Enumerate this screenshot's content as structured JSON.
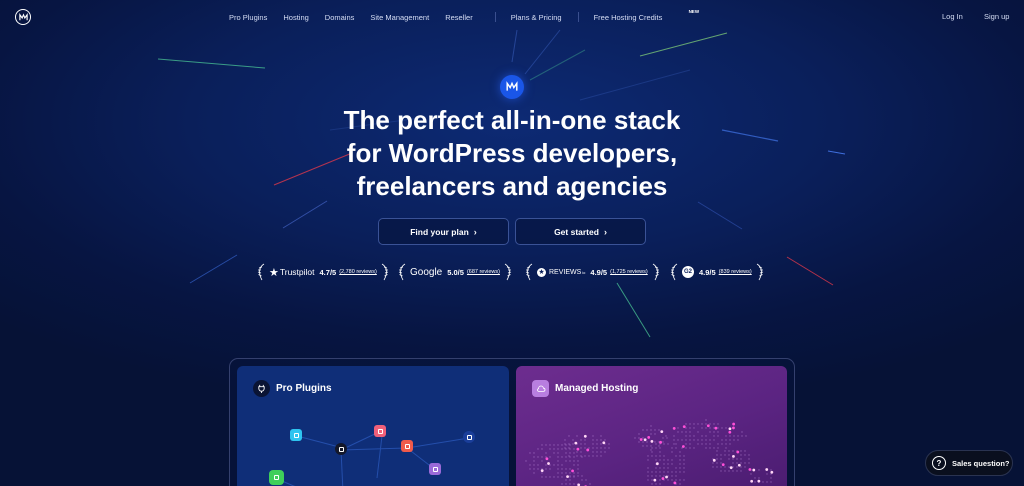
{
  "nav": {
    "links": [
      "Pro Plugins",
      "Hosting",
      "Domains",
      "Site Management",
      "Reseller",
      "Plans & Pricing",
      "Free Hosting Credits"
    ],
    "new_badge": "NEW",
    "login": "Log In",
    "signup": "Sign up"
  },
  "hero": {
    "title_lines": [
      "The perfect all-in-one stack",
      "for WordPress developers,",
      "freelancers and agencies"
    ],
    "btn_plan": "Find your plan",
    "btn_start": "Get started"
  },
  "ratings": [
    {
      "brand": "Trustpilot",
      "score": "4.7/5",
      "reviews": "(2,780 reviews)"
    },
    {
      "brand": "Google",
      "score": "5.0/5",
      "reviews": "(687 reviews)"
    },
    {
      "brand": "REVIEWS",
      "brand_suffix": "io",
      "score": "4.9/5",
      "reviews": "(1,725 reviews)"
    },
    {
      "brand": "G2",
      "score": "4.9/5",
      "reviews": "(839 reviews)"
    }
  ],
  "cards": {
    "plugins_title": "Pro Plugins",
    "hosting_title": "Managed Hosting"
  },
  "sales": {
    "label": "Sales question?"
  },
  "colors": {
    "accent": "#1a56e8",
    "plugins_card": "#0f2e78",
    "hosting_card": "#6d2d8f"
  }
}
